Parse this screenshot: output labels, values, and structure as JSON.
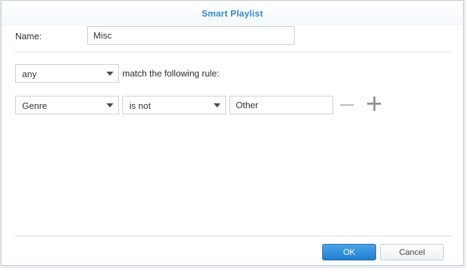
{
  "dialog": {
    "title": "Smart Playlist"
  },
  "name": {
    "label": "Name:",
    "value": "Misc"
  },
  "match": {
    "mode": "any",
    "text": "match the following rule:"
  },
  "rule": {
    "field": "Genre",
    "operator": "is not",
    "value": "Other"
  },
  "footer": {
    "ok_label": "OK",
    "cancel_label": "Cancel"
  }
}
